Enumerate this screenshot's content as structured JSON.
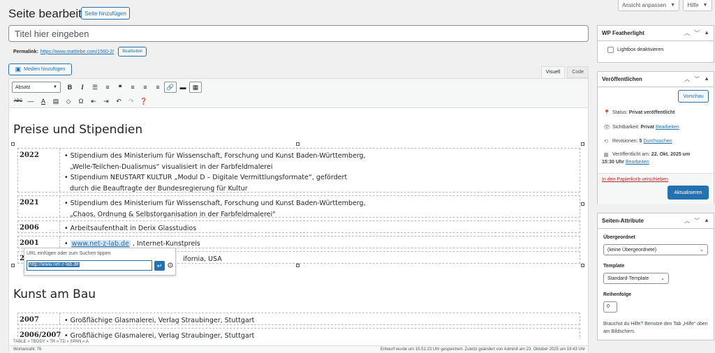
{
  "header": {
    "title": "Seite bearbeiten",
    "add_page": "Seite hinzufügen",
    "screen_options": "Ansicht anpassen",
    "help": "Hilfe"
  },
  "title_field": {
    "placeholder": "Titel hier eingeben"
  },
  "permalink": {
    "label": "Permalink:",
    "url": "https://www.mattiebe.com/1560-2/",
    "edit": "Bearbeiten"
  },
  "media_button": "Medien hinzufügen",
  "editor_tabs": {
    "visual": "Visuell",
    "code": "Code"
  },
  "toolbar": {
    "format_select": "Absatz",
    "row1_icons": [
      "bold-icon",
      "italic-icon",
      "bullet-list-icon",
      "numbered-list-icon",
      "blockquote-icon",
      "align-left-icon",
      "align-center-icon",
      "align-right-icon",
      "link-icon",
      "more-tag-icon",
      "toolbar-toggle-icon"
    ],
    "row2_icons": [
      "strikethrough-icon",
      "horizontal-line-icon",
      "text-color-icon",
      "paste-text-icon",
      "clear-formatting-icon",
      "special-character-icon",
      "outdent-icon",
      "indent-icon",
      "undo-icon",
      "redo-icon",
      "help-icon"
    ]
  },
  "content": {
    "section1_title": "Preise und Stipendien",
    "rows": [
      {
        "year": "2022",
        "lines": [
          "• Stipendium des Ministerium für Wissenschaft, Forschung und Kunst Baden-Württemberg,",
          "„Welle-Teilchen-Dualismus“ visualisiert in der Farbfeldmalerei",
          "• Stipendium NEUSTART KULTUR „Modul D – Digitale Vermittlungsformate“, gefördert",
          "durch die Beauftragte der Bundesregierung für Kultur"
        ]
      },
      {
        "year": "2021",
        "lines": [
          "• Stipendium des Ministerium für Wissenschaft, Forschung und Kunst Baden-Württemberg,",
          "„Chaos, Ordnung & Selbstorganisation in der Farbfeldmalerei\""
        ]
      },
      {
        "year": "2006",
        "lines": [
          "• Arbeitsaufenthalt in Derix Glasstudios"
        ]
      },
      {
        "year": "2001",
        "link": "www.net-z-lab.de",
        "after": " , Internet-Kunstpreis"
      },
      {
        "year": "2",
        "partial": "ifornia, USA"
      }
    ],
    "section2_title": "Kunst am Bau",
    "rows2": [
      {
        "year": "2007",
        "text": "• Großflächige Glasmalerei, Verlag Straubinger, Stuttgart"
      },
      {
        "year": "2006/2007",
        "text": "• Großflächige Glasmalerei, Verlag Straubinger, Stuttgart"
      }
    ]
  },
  "link_popup": {
    "hint": "URL einfügen oder zum Suchen tippen",
    "value": "http://www.net-z-lab.de"
  },
  "status": {
    "path": "TABLE » TBODY » TR » TD » SPAN » A",
    "word_count": "Wortanzahl: 76",
    "saved": "Entwurf wurde um 15:51:23 Uhr gespeichert. Zuletzt geändert von Admin8 am 23. Oktober 2025 um 19:43 Uhr"
  },
  "featherlight": {
    "title": "WP Featherlight",
    "checkbox": "Lightbox deaktivieren"
  },
  "publish": {
    "title": "Veröffentlichen",
    "preview": "Vorschau",
    "status_label": "Status:",
    "status_value": "Privat veröffentlicht",
    "visibility_label": "Sichtbarkeit:",
    "visibility_value": "Privat",
    "visibility_edit": "Bearbeiten",
    "revisions_label": "Revisionen:",
    "revisions_value": "5",
    "revisions_link": "Durchsuchen",
    "published_label": "Veröffentlicht am:",
    "published_value": "22. Okt. 2025 um",
    "published_time": "15:30 Uhr",
    "published_edit": "Bearbeiten",
    "trash": "In den Papierkorb verschieben",
    "update": "Aktualisieren"
  },
  "attributes": {
    "title": "Seiten-Attribute",
    "parent_label": "Übergeordnet",
    "parent_value": "(keine Übergeordnete)",
    "template_label": "Template",
    "template_value": "Standard-Template",
    "order_label": "Reihenfolge",
    "order_value": "0",
    "help_text": "Brauchst du Hilfe? Benutze den Tab „Hilfe“ oben am Bildschirm."
  }
}
